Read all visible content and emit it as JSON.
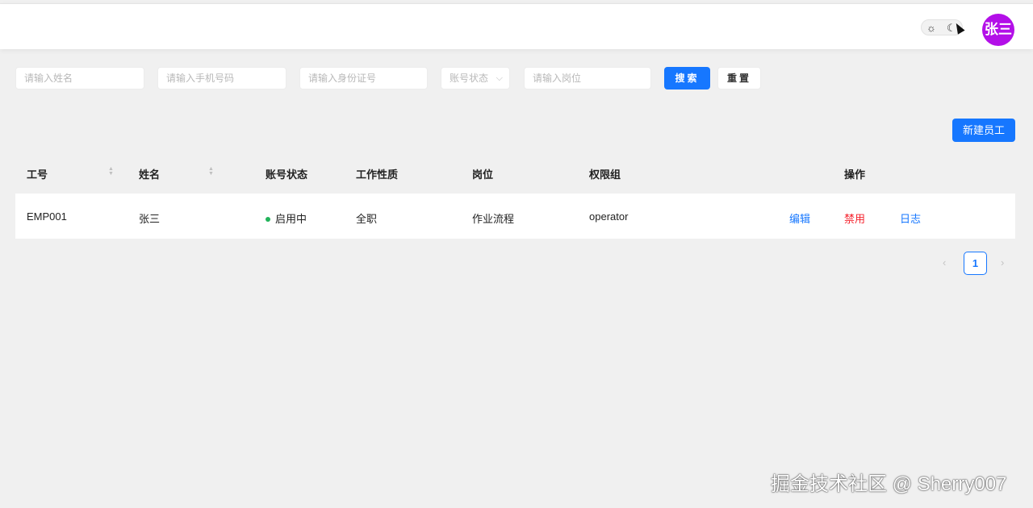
{
  "header": {
    "theme_light_icon": "sun-icon",
    "theme_dark_icon": "moon-icon",
    "avatar_text": "张三",
    "avatar_color": "#b30fe8"
  },
  "filters": {
    "name_placeholder": "请输入姓名",
    "phone_placeholder": "请输入手机号码",
    "id_placeholder": "请输入身份证号",
    "status_placeholder": "账号状态",
    "position_placeholder": "请输入岗位",
    "search_label": "搜索",
    "reset_label": "重置"
  },
  "toolbar": {
    "new_employee_label": "新建员工"
  },
  "table": {
    "columns": [
      "工号",
      "姓名",
      "账号状态",
      "工作性质",
      "岗位",
      "权限组",
      "操作"
    ],
    "rows": [
      {
        "id": "EMP001",
        "name": "张三",
        "status": "启用中",
        "work_type": "全职",
        "position": "作业流程",
        "permission_group": "operator",
        "actions": {
          "edit": "编辑",
          "disable": "禁用",
          "log": "日志"
        }
      }
    ]
  },
  "pagination": {
    "current_page": "1",
    "prev_icon": "chevron-left-icon",
    "next_icon": "chevron-right-icon"
  },
  "colors": {
    "primary": "#1677ff",
    "danger": "#f5222d",
    "status_active": "#21b35a"
  },
  "watermark": "掘金技术社区 @ Sherry007"
}
